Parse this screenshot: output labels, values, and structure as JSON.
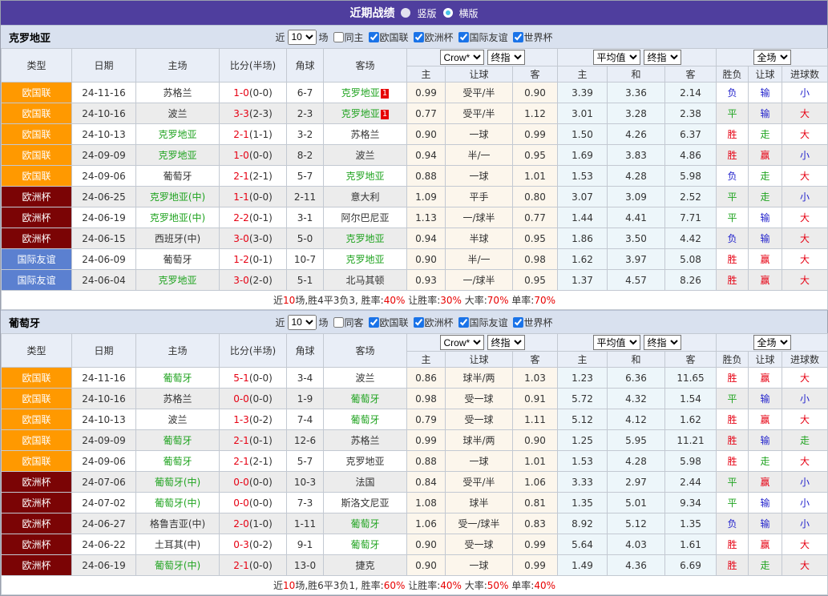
{
  "topbar": {
    "title": "近期战绩",
    "radio_vertical": "竖版",
    "radio_horizontal": "横版"
  },
  "shared": {
    "near_label": "近",
    "games_value": "10",
    "games_unit": "场",
    "leagues": [
      "欧国联",
      "欧洲杯",
      "国际友谊",
      "世界杯"
    ],
    "columns": [
      "类型",
      "日期",
      "主场",
      "比分(半场)",
      "角球",
      "客场"
    ],
    "sub_columns": [
      "主",
      "让球",
      "客",
      "主",
      "和",
      "客",
      "胜负",
      "让球",
      "进球数"
    ],
    "selects": {
      "book": "Crow*",
      "final1": "终指",
      "average": "平均值",
      "final2": "终指",
      "scope": "全场"
    },
    "league_colors": {
      "欧国联": "#ff9900",
      "欧洲杯": "#7b0405",
      "国际友谊": "#5b80d0"
    },
    "result_colors": {
      "red": "#e60012",
      "green": "#1fa31f",
      "blue": "#2323cc"
    }
  },
  "sections": [
    {
      "title": "克罗地亚",
      "same_label": "同主",
      "rows": [
        {
          "league": "欧国联",
          "date": "24-11-16",
          "home": {
            "name": "苏格兰"
          },
          "ft": "1-0",
          "ht": "(0-0)",
          "corner": "6-7",
          "away": {
            "name": "克罗地亚",
            "focus": true,
            "badge": "1"
          },
          "odds": [
            "0.99",
            "受平/半",
            "0.90"
          ],
          "avg": [
            "3.39",
            "3.36",
            "2.14"
          ],
          "res": [
            [
              "负",
              "blue"
            ],
            [
              "输",
              "blue"
            ],
            [
              "小",
              "blue"
            ]
          ]
        },
        {
          "league": "欧国联",
          "date": "24-10-16",
          "home": {
            "name": "波兰"
          },
          "ft": "3-3",
          "ht": "(2-3)",
          "corner": "2-3",
          "away": {
            "name": "克罗地亚",
            "focus": true,
            "badge": "1"
          },
          "odds": [
            "0.77",
            "受平/半",
            "1.12"
          ],
          "avg": [
            "3.01",
            "3.28",
            "2.38"
          ],
          "res": [
            [
              "平",
              "green"
            ],
            [
              "输",
              "blue"
            ],
            [
              "大",
              "red"
            ]
          ]
        },
        {
          "league": "欧国联",
          "date": "24-10-13",
          "home": {
            "name": "克罗地亚",
            "focus": true
          },
          "ft": "2-1",
          "ht": "(1-1)",
          "corner": "3-2",
          "away": {
            "name": "苏格兰"
          },
          "odds": [
            "0.90",
            "一球",
            "0.99"
          ],
          "avg": [
            "1.50",
            "4.26",
            "6.37"
          ],
          "res": [
            [
              "胜",
              "red"
            ],
            [
              "走",
              "green"
            ],
            [
              "大",
              "red"
            ]
          ]
        },
        {
          "league": "欧国联",
          "date": "24-09-09",
          "home": {
            "name": "克罗地亚",
            "focus": true
          },
          "ft": "1-0",
          "ht": "(0-0)",
          "corner": "8-2",
          "away": {
            "name": "波兰"
          },
          "odds": [
            "0.94",
            "半/一",
            "0.95"
          ],
          "avg": [
            "1.69",
            "3.83",
            "4.86"
          ],
          "res": [
            [
              "胜",
              "red"
            ],
            [
              "赢",
              "red"
            ],
            [
              "小",
              "blue"
            ]
          ]
        },
        {
          "league": "欧国联",
          "date": "24-09-06",
          "home": {
            "name": "葡萄牙"
          },
          "ft": "2-1",
          "ht": "(2-1)",
          "corner": "5-7",
          "away": {
            "name": "克罗地亚",
            "focus": true
          },
          "odds": [
            "0.88",
            "一球",
            "1.01"
          ],
          "avg": [
            "1.53",
            "4.28",
            "5.98"
          ],
          "res": [
            [
              "负",
              "blue"
            ],
            [
              "走",
              "green"
            ],
            [
              "大",
              "red"
            ]
          ]
        },
        {
          "league": "欧洲杯",
          "date": "24-06-25",
          "home": {
            "name": "克罗地亚(中)",
            "focus": true
          },
          "ft": "1-1",
          "ht": "(0-0)",
          "corner": "2-11",
          "away": {
            "name": "意大利"
          },
          "odds": [
            "1.09",
            "平手",
            "0.80"
          ],
          "avg": [
            "3.07",
            "3.09",
            "2.52"
          ],
          "res": [
            [
              "平",
              "green"
            ],
            [
              "走",
              "green"
            ],
            [
              "小",
              "blue"
            ]
          ]
        },
        {
          "league": "欧洲杯",
          "date": "24-06-19",
          "home": {
            "name": "克罗地亚(中)",
            "focus": true
          },
          "ft": "2-2",
          "ht": "(0-1)",
          "corner": "3-1",
          "away": {
            "name": "阿尔巴尼亚"
          },
          "odds": [
            "1.13",
            "一/球半",
            "0.77"
          ],
          "avg": [
            "1.44",
            "4.41",
            "7.71"
          ],
          "res": [
            [
              "平",
              "green"
            ],
            [
              "输",
              "blue"
            ],
            [
              "大",
              "red"
            ]
          ]
        },
        {
          "league": "欧洲杯",
          "date": "24-06-15",
          "home": {
            "name": "西班牙(中)"
          },
          "ft": "3-0",
          "ht": "(3-0)",
          "corner": "5-0",
          "away": {
            "name": "克罗地亚",
            "focus": true
          },
          "odds": [
            "0.94",
            "半球",
            "0.95"
          ],
          "avg": [
            "1.86",
            "3.50",
            "4.42"
          ],
          "res": [
            [
              "负",
              "blue"
            ],
            [
              "输",
              "blue"
            ],
            [
              "大",
              "red"
            ]
          ]
        },
        {
          "league": "国际友谊",
          "date": "24-06-09",
          "home": {
            "name": "葡萄牙"
          },
          "ft": "1-2",
          "ht": "(0-1)",
          "corner": "10-7",
          "away": {
            "name": "克罗地亚",
            "focus": true
          },
          "odds": [
            "0.90",
            "半/一",
            "0.98"
          ],
          "avg": [
            "1.62",
            "3.97",
            "5.08"
          ],
          "res": [
            [
              "胜",
              "red"
            ],
            [
              "赢",
              "red"
            ],
            [
              "大",
              "red"
            ]
          ]
        },
        {
          "league": "国际友谊",
          "date": "24-06-04",
          "home": {
            "name": "克罗地亚",
            "focus": true
          },
          "ft": "3-0",
          "ht": "(2-0)",
          "corner": "5-1",
          "away": {
            "name": "北马其顿"
          },
          "odds": [
            "0.93",
            "一/球半",
            "0.95"
          ],
          "avg": [
            "1.37",
            "4.57",
            "8.26"
          ],
          "res": [
            [
              "胜",
              "red"
            ],
            [
              "赢",
              "red"
            ],
            [
              "大",
              "red"
            ]
          ]
        }
      ],
      "summary": {
        "prefix": "近",
        "count": "10",
        "mid1": "场,胜4平3负3, 胜率:",
        "v1": "40%",
        "mid2": " 让胜率:",
        "v2": "30%",
        "mid3": " 大率:",
        "v3": "70%",
        "mid4": " 单率:",
        "v4": "70%"
      }
    },
    {
      "title": "葡萄牙",
      "same_label": "同客",
      "rows": [
        {
          "league": "欧国联",
          "date": "24-11-16",
          "home": {
            "name": "葡萄牙",
            "focus": true
          },
          "ft": "5-1",
          "ht": "(0-0)",
          "corner": "3-4",
          "away": {
            "name": "波兰"
          },
          "odds": [
            "0.86",
            "球半/两",
            "1.03"
          ],
          "avg": [
            "1.23",
            "6.36",
            "11.65"
          ],
          "res": [
            [
              "胜",
              "red"
            ],
            [
              "赢",
              "red"
            ],
            [
              "大",
              "red"
            ]
          ]
        },
        {
          "league": "欧国联",
          "date": "24-10-16",
          "home": {
            "name": "苏格兰"
          },
          "ft": "0-0",
          "ht": "(0-0)",
          "corner": "1-9",
          "away": {
            "name": "葡萄牙",
            "focus": true
          },
          "odds": [
            "0.98",
            "受一球",
            "0.91"
          ],
          "avg": [
            "5.72",
            "4.32",
            "1.54"
          ],
          "res": [
            [
              "平",
              "green"
            ],
            [
              "输",
              "blue"
            ],
            [
              "小",
              "blue"
            ]
          ]
        },
        {
          "league": "欧国联",
          "date": "24-10-13",
          "home": {
            "name": "波兰"
          },
          "ft": "1-3",
          "ht": "(0-2)",
          "corner": "7-4",
          "away": {
            "name": "葡萄牙",
            "focus": true
          },
          "odds": [
            "0.79",
            "受一球",
            "1.11"
          ],
          "avg": [
            "5.12",
            "4.12",
            "1.62"
          ],
          "res": [
            [
              "胜",
              "red"
            ],
            [
              "赢",
              "red"
            ],
            [
              "大",
              "red"
            ]
          ]
        },
        {
          "league": "欧国联",
          "date": "24-09-09",
          "home": {
            "name": "葡萄牙",
            "focus": true
          },
          "ft": "2-1",
          "ht": "(0-1)",
          "corner": "12-6",
          "away": {
            "name": "苏格兰"
          },
          "odds": [
            "0.99",
            "球半/两",
            "0.90"
          ],
          "avg": [
            "1.25",
            "5.95",
            "11.21"
          ],
          "res": [
            [
              "胜",
              "red"
            ],
            [
              "输",
              "blue"
            ],
            [
              "走",
              "green"
            ]
          ]
        },
        {
          "league": "欧国联",
          "date": "24-09-06",
          "home": {
            "name": "葡萄牙",
            "focus": true
          },
          "ft": "2-1",
          "ht": "(2-1)",
          "corner": "5-7",
          "away": {
            "name": "克罗地亚"
          },
          "odds": [
            "0.88",
            "一球",
            "1.01"
          ],
          "avg": [
            "1.53",
            "4.28",
            "5.98"
          ],
          "res": [
            [
              "胜",
              "red"
            ],
            [
              "走",
              "green"
            ],
            [
              "大",
              "red"
            ]
          ]
        },
        {
          "league": "欧洲杯",
          "date": "24-07-06",
          "home": {
            "name": "葡萄牙(中)",
            "focus": true
          },
          "ft": "0-0",
          "ht": "(0-0)",
          "corner": "10-3",
          "away": {
            "name": "法国"
          },
          "odds": [
            "0.84",
            "受平/半",
            "1.06"
          ],
          "avg": [
            "3.33",
            "2.97",
            "2.44"
          ],
          "res": [
            [
              "平",
              "green"
            ],
            [
              "赢",
              "red"
            ],
            [
              "小",
              "blue"
            ]
          ]
        },
        {
          "league": "欧洲杯",
          "date": "24-07-02",
          "home": {
            "name": "葡萄牙(中)",
            "focus": true
          },
          "ft": "0-0",
          "ht": "(0-0)",
          "corner": "7-3",
          "away": {
            "name": "斯洛文尼亚"
          },
          "odds": [
            "1.08",
            "球半",
            "0.81"
          ],
          "avg": [
            "1.35",
            "5.01",
            "9.34"
          ],
          "res": [
            [
              "平",
              "green"
            ],
            [
              "输",
              "blue"
            ],
            [
              "小",
              "blue"
            ]
          ]
        },
        {
          "league": "欧洲杯",
          "date": "24-06-27",
          "home": {
            "name": "格鲁吉亚(中)"
          },
          "ft": "2-0",
          "ht": "(1-0)",
          "corner": "1-11",
          "away": {
            "name": "葡萄牙",
            "focus": true
          },
          "odds": [
            "1.06",
            "受一/球半",
            "0.83"
          ],
          "avg": [
            "8.92",
            "5.12",
            "1.35"
          ],
          "res": [
            [
              "负",
              "blue"
            ],
            [
              "输",
              "blue"
            ],
            [
              "小",
              "blue"
            ]
          ]
        },
        {
          "league": "欧洲杯",
          "date": "24-06-22",
          "home": {
            "name": "土耳其(中)"
          },
          "ft": "0-3",
          "ht": "(0-2)",
          "corner": "9-1",
          "away": {
            "name": "葡萄牙",
            "focus": true
          },
          "odds": [
            "0.90",
            "受一球",
            "0.99"
          ],
          "avg": [
            "5.64",
            "4.03",
            "1.61"
          ],
          "res": [
            [
              "胜",
              "red"
            ],
            [
              "赢",
              "red"
            ],
            [
              "大",
              "red"
            ]
          ]
        },
        {
          "league": "欧洲杯",
          "date": "24-06-19",
          "home": {
            "name": "葡萄牙(中)",
            "focus": true
          },
          "ft": "2-1",
          "ht": "(0-0)",
          "corner": "13-0",
          "away": {
            "name": "捷克"
          },
          "odds": [
            "0.90",
            "一球",
            "0.99"
          ],
          "avg": [
            "1.49",
            "4.36",
            "6.69"
          ],
          "res": [
            [
              "胜",
              "red"
            ],
            [
              "走",
              "green"
            ],
            [
              "大",
              "red"
            ]
          ]
        }
      ],
      "summary": {
        "prefix": "近",
        "count": "10",
        "mid1": "场,胜6平3负1, 胜率:",
        "v1": "60%",
        "mid2": " 让胜率:",
        "v2": "40%",
        "mid3": " 大率:",
        "v3": "50%",
        "mid4": " 单率:",
        "v4": "40%"
      }
    }
  ]
}
